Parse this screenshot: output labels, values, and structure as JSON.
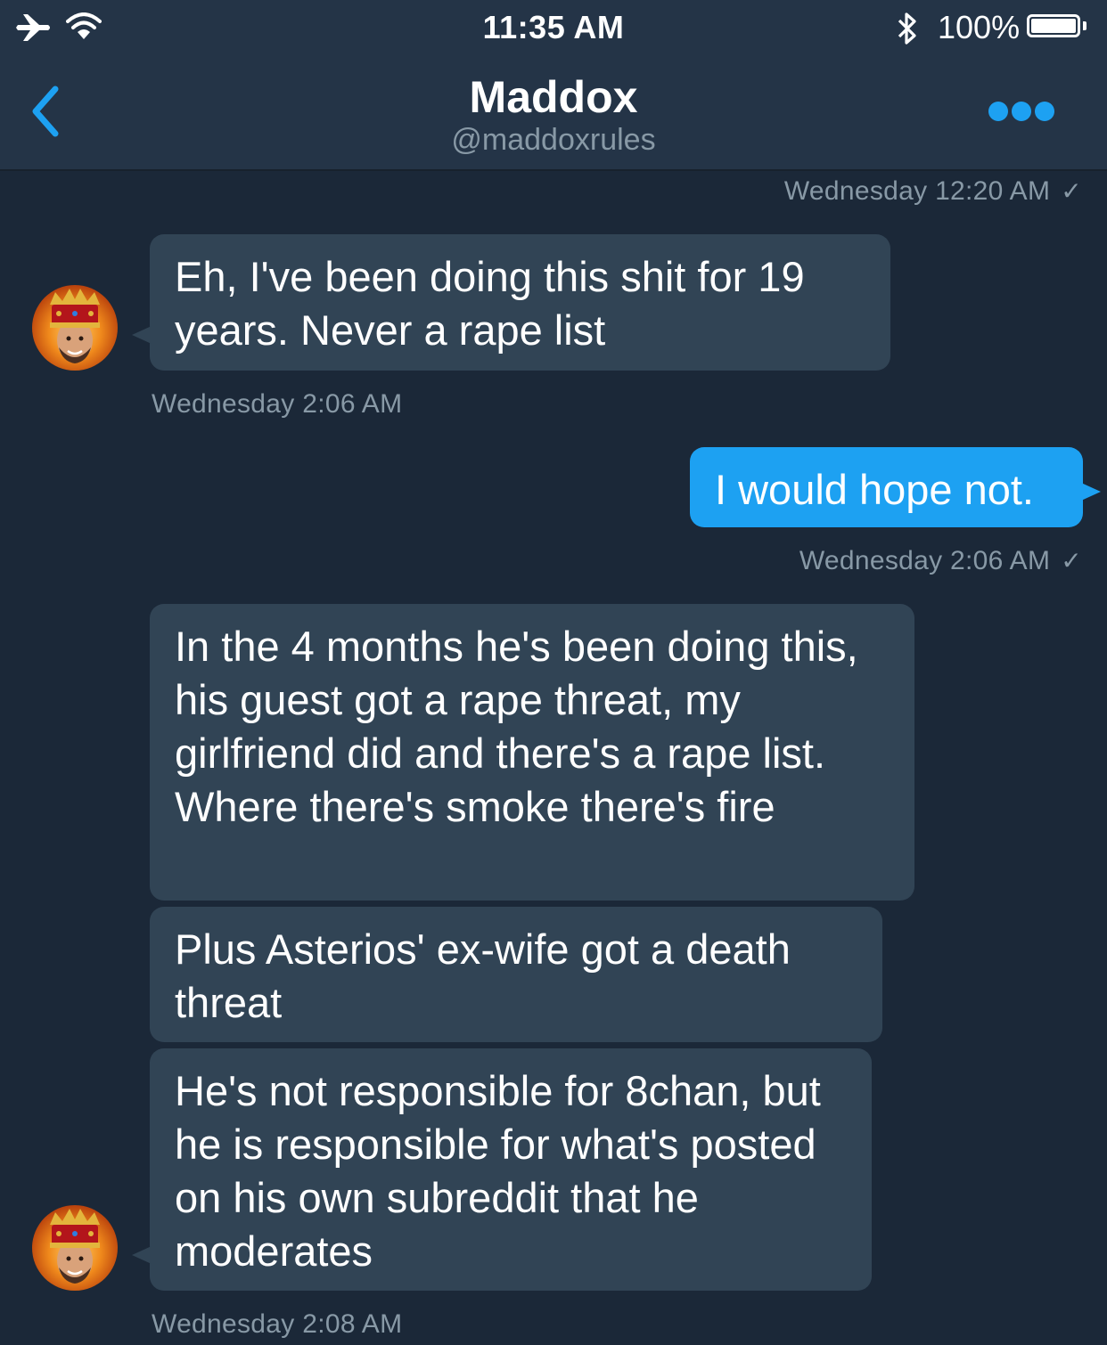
{
  "status_bar": {
    "time": "11:35 AM",
    "battery_percent": "100%",
    "battery_level": 1.0,
    "icons": [
      "airplane-icon",
      "wifi-icon",
      "bluetooth-icon",
      "battery-icon"
    ]
  },
  "header": {
    "title": "Maddox",
    "handle": "@maddoxrules"
  },
  "colors": {
    "background": "#1b2838",
    "header_bg": "#243447",
    "incoming_bubble": "#314455",
    "outgoing_bubble": "#1da1f2",
    "accent": "#1da1f2",
    "muted_text": "#8899a6"
  },
  "conversation": {
    "read_check": "✓",
    "top_timestamp": "Wednesday 12:20 AM",
    "messages": [
      {
        "direction": "incoming",
        "text": "Eh, I've been doing this shit for 19 years. Never a rape list",
        "timestamp": "Wednesday 2:06 AM"
      },
      {
        "direction": "outgoing",
        "text": "I would hope not.",
        "timestamp": "Wednesday 2:06 AM"
      },
      {
        "direction": "incoming",
        "text": "In the 4 months he's been doing this, his guest got a rape threat, my girlfriend did and there's a rape list. Where there's smoke there's fire"
      },
      {
        "direction": "incoming",
        "text": "Plus Asterios' ex-wife got a death threat"
      },
      {
        "direction": "incoming",
        "text": "He's not responsible for 8chan, but he is responsible for what's posted on his own subreddit that he moderates",
        "timestamp": "Wednesday 2:08 AM"
      }
    ]
  }
}
